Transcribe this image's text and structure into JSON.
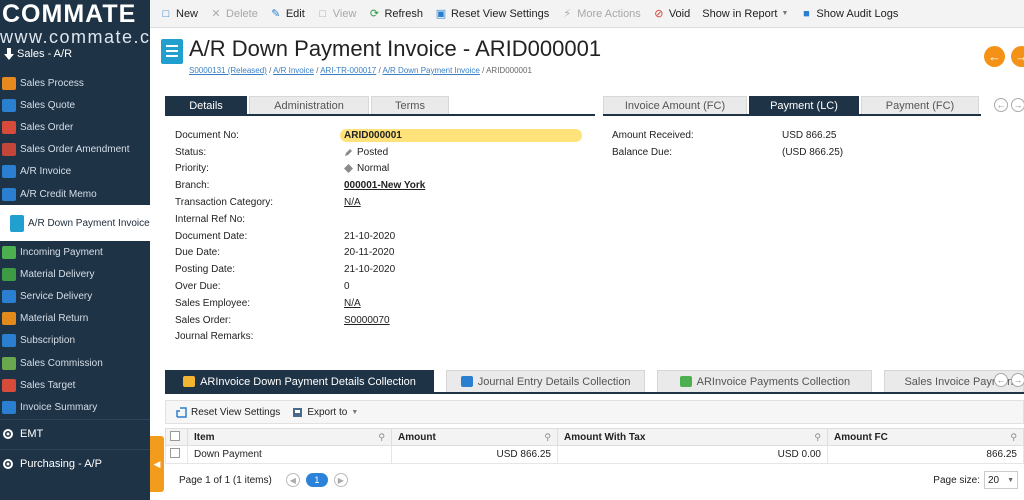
{
  "brand": {
    "logo_text": "COMMATE",
    "logo_sub": "www.commate.ca"
  },
  "sidebar": {
    "module": "Sales - A/R",
    "items": [
      {
        "label": "Sales Process",
        "icon": "sales-process-icon",
        "color": "#e6891f"
      },
      {
        "label": "Sales Quote",
        "icon": "sales-quote-icon",
        "color": "#2b7fd0"
      },
      {
        "label": "Sales Order",
        "icon": "sales-order-icon",
        "color": "#d64b3a"
      },
      {
        "label": "Sales Order Amendment",
        "icon": "sales-order-amendment-icon",
        "color": "#c4453a"
      },
      {
        "label": "A/R Invoice",
        "icon": "ar-invoice-icon",
        "color": "#2b7fd0"
      },
      {
        "label": "A/R Credit Memo",
        "icon": "ar-credit-memo-icon",
        "color": "#2b7fd0"
      },
      {
        "label": "A/R Down Payment Invoice",
        "icon": "ar-down-payment-invoice-icon",
        "color": "#21a0cf",
        "active": true
      },
      {
        "label": "Incoming Payment",
        "icon": "incoming-payment-icon",
        "color": "#4caf50"
      },
      {
        "label": "Material Delivery",
        "icon": "material-delivery-icon",
        "color": "#3d9b46"
      },
      {
        "label": "Service Delivery",
        "icon": "service-delivery-icon",
        "color": "#2b7fd0"
      },
      {
        "label": "Material Return",
        "icon": "material-return-icon",
        "color": "#e38a1c"
      },
      {
        "label": "Subscription",
        "icon": "subscription-icon",
        "color": "#2b7fd0"
      },
      {
        "label": "Sales Commission",
        "icon": "sales-commission-icon",
        "color": "#6aa84f"
      },
      {
        "label": "Sales Target",
        "icon": "sales-target-icon",
        "color": "#d64b3a"
      },
      {
        "label": "Invoice Summary",
        "icon": "invoice-summary-icon",
        "color": "#2b7fd0"
      }
    ],
    "sections": [
      {
        "label": "EMT",
        "icon": "gear-icon"
      },
      {
        "label": "Purchasing - A/P",
        "icon": "purchasing-icon"
      }
    ]
  },
  "toolbar": {
    "items": [
      {
        "label": "New",
        "icon": "new-document-icon",
        "enabled": true
      },
      {
        "label": "Delete",
        "icon": "delete-icon",
        "enabled": false
      },
      {
        "label": "Edit",
        "icon": "edit-icon",
        "enabled": true
      },
      {
        "label": "View",
        "icon": "view-icon",
        "enabled": false
      },
      {
        "label": "Refresh",
        "icon": "refresh-icon",
        "enabled": true
      },
      {
        "label": "Reset View Settings",
        "icon": "reset-view-icon",
        "enabled": true
      },
      {
        "label": "More Actions",
        "icon": "more-actions-icon",
        "enabled": false
      },
      {
        "label": "Void",
        "icon": "void-icon",
        "enabled": true
      },
      {
        "label": "Show in Report",
        "icon": "",
        "enabled": true,
        "dropdown": true
      },
      {
        "label": "Show Audit Logs",
        "icon": "audit-logs-icon",
        "enabled": true
      }
    ]
  },
  "header": {
    "title": "A/R Down Payment Invoice - ARID000001",
    "breadcrumb": [
      {
        "label": "S0000131 (Released)",
        "link": true
      },
      {
        "label": "A/R Invoice",
        "link": true
      },
      {
        "label": "ARI-TR-000017",
        "link": true
      },
      {
        "label": "A/R Down Payment Invoice",
        "link": true
      },
      {
        "label": "ARID000001",
        "link": false
      }
    ],
    "separator": " / "
  },
  "tabs_left": [
    {
      "label": "Details",
      "active": true
    },
    {
      "label": "Administration",
      "active": false
    },
    {
      "label": "Terms",
      "active": false
    }
  ],
  "tabs_right": [
    {
      "label": "Invoice Amount (FC)",
      "active": false
    },
    {
      "label": "Payment (LC)",
      "active": true
    },
    {
      "label": "Payment (FC)",
      "active": false
    }
  ],
  "details": [
    {
      "label": "Document No:",
      "value": "ARID000001",
      "style": "docno"
    },
    {
      "label": "Status:",
      "value": "Posted",
      "icon": "pencil-icon"
    },
    {
      "label": "Priority:",
      "value": "Normal",
      "icon": "diamond-icon"
    },
    {
      "label": "Branch:",
      "value": "000001-New York",
      "style": "bold-link"
    },
    {
      "label": "Transaction Category:",
      "value": "N/A",
      "style": "link"
    },
    {
      "label": "Internal Ref No:",
      "value": ""
    },
    {
      "label": "Document Date:",
      "value": "21-10-2020"
    },
    {
      "label": "Due Date:",
      "value": "20-11-2020"
    },
    {
      "label": "Posting Date:",
      "value": "21-10-2020"
    },
    {
      "label": "Over Due:",
      "value": "0"
    },
    {
      "label": "Sales Employee:",
      "value": "N/A",
      "style": "link"
    },
    {
      "label": "Sales Order:",
      "value": "S0000070",
      "style": "link"
    },
    {
      "label": "Journal Remarks:",
      "value": ""
    }
  ],
  "payment_lc": [
    {
      "label": "Amount Received:",
      "value": "USD 866.25"
    },
    {
      "label": "Balance Due:",
      "value": "(USD 866.25)"
    }
  ],
  "bottom_tabs": [
    {
      "label": "ARInvoice Down Payment Details Collection",
      "active": true,
      "icon": "folder-icon",
      "color": "#f2b431"
    },
    {
      "label": "Journal Entry Details Collection",
      "active": false,
      "icon": "journal-icon",
      "color": "#2b7fd0"
    },
    {
      "label": "ARInvoice Payments Collection",
      "active": false,
      "icon": "payments-icon",
      "color": "#4caf50"
    },
    {
      "label": "Sales Invoice Payments Collection",
      "active": false,
      "icon": "payments-icon",
      "color": "#4caf50"
    }
  ],
  "grid_toolbar": {
    "reset_label": "Reset View Settings",
    "export_label": "Export to"
  },
  "grid": {
    "columns": [
      "Item",
      "Amount",
      "Amount With Tax",
      "Amount FC"
    ],
    "rows": [
      {
        "item": "Down Payment",
        "amount": "USD 866.25",
        "amount_with_tax": "USD 0.00",
        "amount_fc": "866.25"
      }
    ]
  },
  "pager": {
    "summary": "Page 1 of 1 (1 items)",
    "current": "1",
    "page_size_label": "Page size:",
    "page_size": "20"
  },
  "colors": {
    "sidebar_bg": "#1f3346",
    "accent_orange": "#f39217",
    "docno_highlight": "#ffe37a",
    "link_blue": "#3b80c6"
  }
}
